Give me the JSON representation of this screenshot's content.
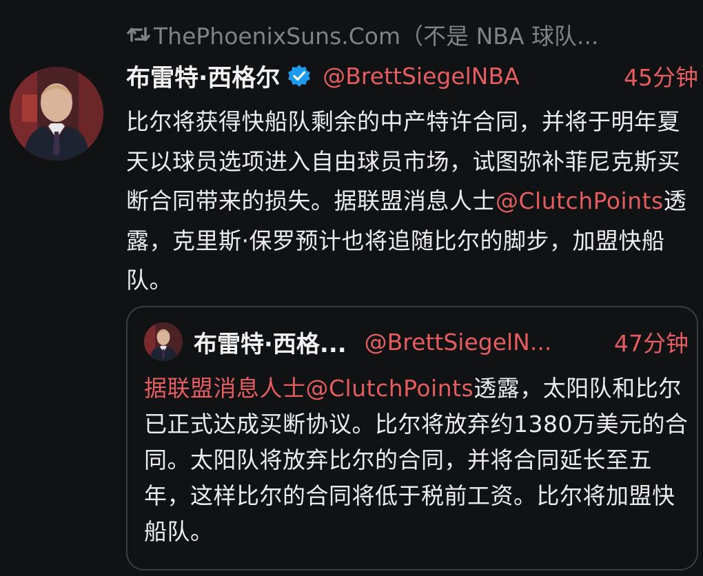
{
  "retweet": {
    "icon": "retweet-icon",
    "text": "ThePhoenixSuns.Com（不是 NBA 球队..."
  },
  "tweet": {
    "author_name": "布雷特·西格尔",
    "verified_icon": "verified-badge-icon",
    "handle": "@BrettSiegelNBA",
    "time": "45分钟",
    "body_part1": "比尔将获得快船队剩余的中产特许合同，并将于明年夏天以球员选项进入自由球员市场，试图弥补菲尼克斯买断合同带来的损失。据联盟消息人士",
    "body_mention": "@ClutchPoints",
    "body_part2": "透露，克里斯·保罗预计也将追随比尔的脚步，加盟快船队。"
  },
  "quote": {
    "author_name": "布雷特·西格...",
    "handle": "@BrettSiegelN...",
    "time": "47分钟",
    "body_red": "据联盟消息人士@ClutchPoints",
    "body_rest": "透露，太阳队和比尔已正式达成买断协议。比尔将放弃约1380万美元的合同。太阳队将放弃比尔的合同，并将合同延长至五年，这样比尔的合同将低于税前工资。比尔将加盟快船队。"
  },
  "colors": {
    "background": "#111214",
    "accent": "#e55d5f",
    "muted": "#7f8287",
    "verified": "#1d9bf0"
  }
}
